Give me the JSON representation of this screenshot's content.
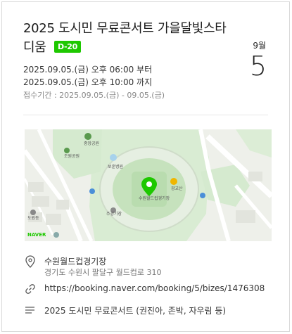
{
  "event": {
    "title": "2025 도시민 무료콘서트 가을달빛스타디움",
    "dday": "D-20",
    "month": "9월",
    "day": "5",
    "time_start": "2025.09.05.(금) 오후 06:00 부터",
    "time_end": "2025.09.05.(금) 오후 10:00 까지",
    "registration": "접수기간 : 2025.09.05.(금) - 09.05.(금)"
  },
  "map": {
    "provider_logo": "NAVER",
    "labels": {
      "park_center": "중앙공원",
      "place_a": "조원공원",
      "place_b": "보훈병원",
      "station_a": "만석공원",
      "stadium_name": "수원월드컵경기장",
      "place_c": "주경기장",
      "place_d": "도원동",
      "place_e": "광교산"
    },
    "colors": {
      "park": "#cfe8c8",
      "water": "#bfe0f2",
      "pin": "#1ec800"
    }
  },
  "location": {
    "name": "수원월드컵경기장",
    "address": "경기도 수원시 팔달구 월드컵로 310"
  },
  "link": {
    "url": "https://booking.naver.com/booking/5/bizes/1476308"
  },
  "description": {
    "text": "2025 도시민 무료콘서트 (권진아, 존박, 자우림 등)"
  }
}
